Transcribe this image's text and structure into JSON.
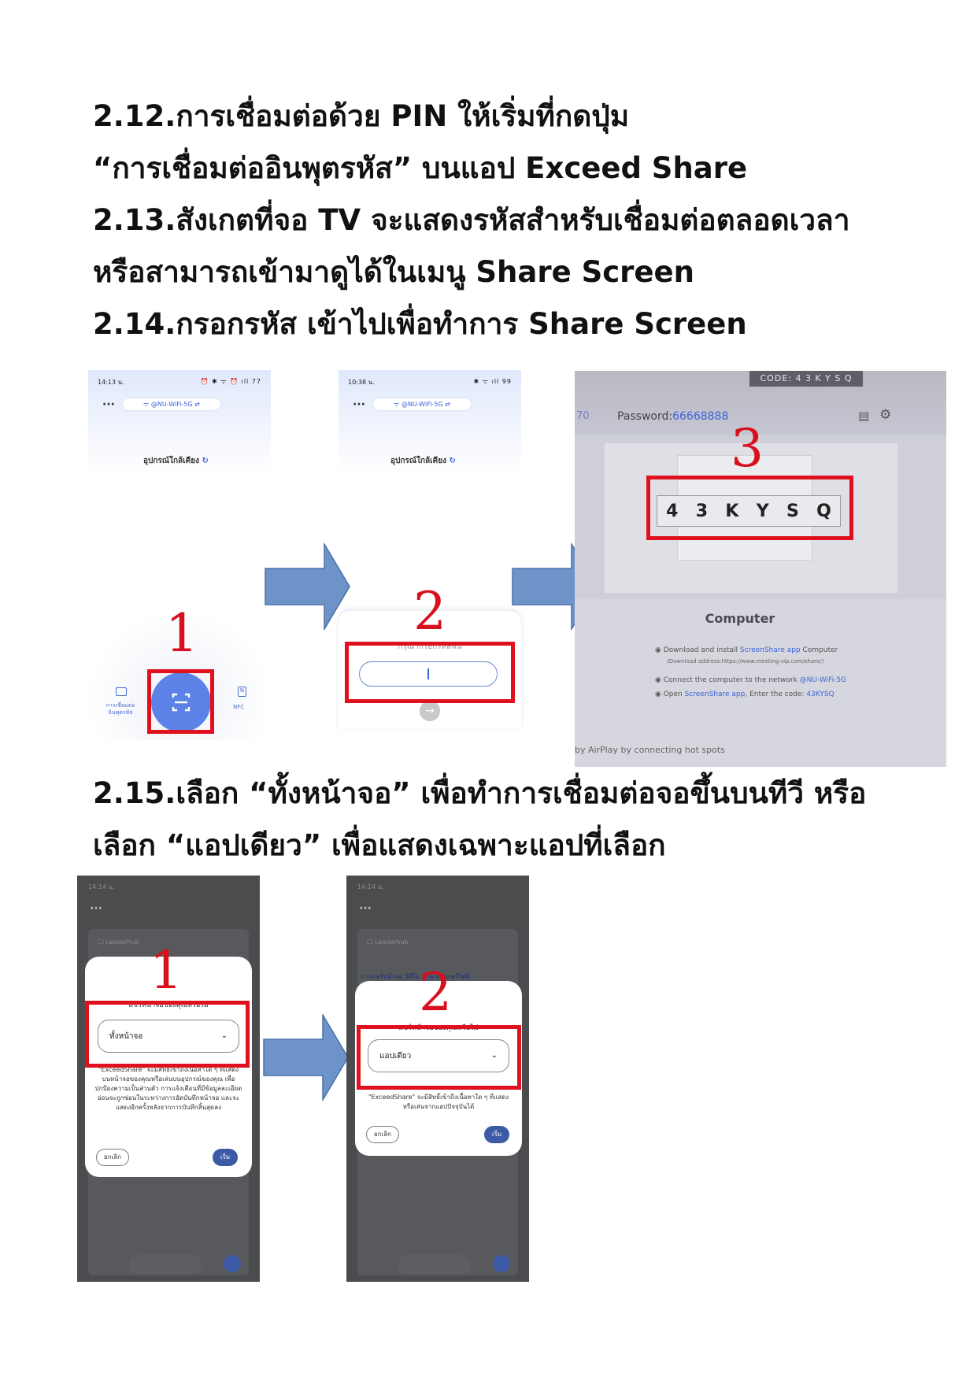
{
  "instructions": {
    "line1": "2.12.การเชื่อมต่อด้วย PIN ให้เริ่มที่กดปุ่ม",
    "line2": "“การเชื่อมต่ออินพุตรหัส” บนแอป Exceed Share",
    "line3": "2.13.สังเกตที่จอ TV จะแสดงรหัสสำหรับเชื่อมต่อตลอดเวลา",
    "line4": "หรือสามารถเข้ามาดูได้ในเมนู Share Screen",
    "line5": "2.14.กรอกรหัส เข้าไปเพื่อทำการ Share Screen",
    "line6": "2.15.เลือก “ทั้งหน้าจอ” เพื่อทำการเชื่อมต่อจอขึ้นบนทีวี หรือ",
    "line7": "เลือก “แอปเดียว” เพื่อแสดงเฉพาะแอปที่เลือก"
  },
  "step_numbers": {
    "a1": "1",
    "a2": "2",
    "a3": "3",
    "b1": "1",
    "b2": "2"
  },
  "phone1": {
    "time": "14:13 น.",
    "status_icons": "⏰ ✱ ᯤ ⏰ ıll 77",
    "dots": "···",
    "wifi": "@NU-WiFi-5G",
    "nearby": "อุปกรณ์ใกล้เคียง",
    "pin_label_1": "การเชื่อมต่อ",
    "pin_label_2": "อินพุตรหัส",
    "nfc_label": "NFC"
  },
  "phone2": {
    "time": "10:38 น.",
    "status_icons": "✱ ᯤ ıll 99",
    "dots": "···",
    "wifi": "@NU-WiFi-5G",
    "nearby": "อุปกรณ์ใกล้เคียง",
    "pin_prompt": "กรุณากรอกรหัสพิน"
  },
  "tv": {
    "code_banner": "CODE: 4 3 K Y S Q",
    "left_num": "70",
    "password_label": "Password:",
    "password_value": "66668888",
    "code_chars": [
      "4",
      "3",
      "K",
      "Y",
      "S",
      "Q"
    ],
    "section_title": "Computer",
    "step1_pre": "Download and install ",
    "step1_link": "ScreenShare app",
    "step1_post": " Computer",
    "step1_sub": "(Download address:https://www.meeting-vip.com/share/)",
    "step2_pre": "Connect the computer to the network ",
    "step2_link": "@NU-WiFi-5G",
    "step3_pre": "Open ",
    "step3_link": "ScreenShare app",
    "step3_mid": ", Enter the code: ",
    "step3_code": "43KYSQ",
    "footer": "by AirPlay by connecting hot spots"
  },
  "phone3": {
    "time": "14:14 น.",
    "dots": "···",
    "device": "Leaderhub",
    "dialog_title": "แชร์หน้าจอของคุณหรือไม่",
    "selected": "ทั้งหน้าจอ",
    "description": "\"ExceedShare\" จะมีสิทธิ์เข้าถึงเนื้อหาใด ๆ ที่แสดงบนหน้าจอของคุณหรือเล่นบนอุปกรณ์ของคุณ เพื่อปกป้องความเป็นส่วนตัว การแจ้งเตือนที่มีข้อมูลละเอียดอ่อนจะถูกซ่อนในระหว่างการอัดบันทึกหน้าจอ และจะแสดงอีกครั้งหลังจากการบันทึกสิ้นสุดลง",
    "cancel": "ยกเลิก",
    "start": "เริ่ม"
  },
  "phone4": {
    "time": "14:14 น.",
    "dots": "···",
    "device": "Leaderhub",
    "tabs": "การแชร์หน้าจอ  วิดีโอ  ภาพ  การแชร์ไฟล์",
    "dialog_title": "แชร์หน้าจอของคุณหรือไม่",
    "selected": "แอปเดียว",
    "description": "\"ExceedShare\" จะมีสิทธิ์เข้าถึงเนื้อหาใด ๆ ที่แสดงหรือเล่นจากแอปปัจจุบันได้",
    "cancel": "ยกเลิก",
    "start": "เริ่ม"
  }
}
